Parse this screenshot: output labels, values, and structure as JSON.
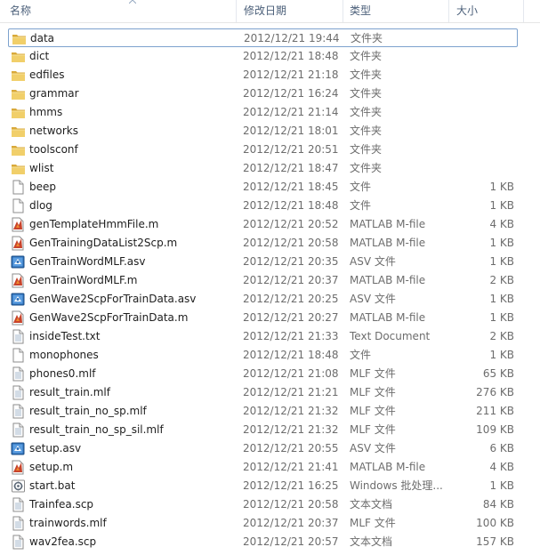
{
  "columns": {
    "name": "名称",
    "modified": "修改日期",
    "type": "类型",
    "size": "大小"
  },
  "colors": {
    "header_text": "#4c607a",
    "focus_border": "#7da2ce",
    "folder": "#e8c252",
    "matlab": "#c0392b"
  },
  "files": [
    {
      "name": "data",
      "date": "2012/12/21 19:44",
      "type": "文件夹",
      "size": "",
      "icon": "folder-icon"
    },
    {
      "name": "dict",
      "date": "2012/12/21 18:48",
      "type": "文件夹",
      "size": "",
      "icon": "folder-icon"
    },
    {
      "name": "edfiles",
      "date": "2012/12/21 21:18",
      "type": "文件夹",
      "size": "",
      "icon": "folder-icon"
    },
    {
      "name": "grammar",
      "date": "2012/12/21 16:24",
      "type": "文件夹",
      "size": "",
      "icon": "folder-icon"
    },
    {
      "name": "hmms",
      "date": "2012/12/21 21:14",
      "type": "文件夹",
      "size": "",
      "icon": "folder-icon"
    },
    {
      "name": "networks",
      "date": "2012/12/21 18:01",
      "type": "文件夹",
      "size": "",
      "icon": "folder-icon"
    },
    {
      "name": "toolsconf",
      "date": "2012/12/21 20:51",
      "type": "文件夹",
      "size": "",
      "icon": "folder-icon"
    },
    {
      "name": "wlist",
      "date": "2012/12/21 18:47",
      "type": "文件夹",
      "size": "",
      "icon": "folder-icon"
    },
    {
      "name": "beep",
      "date": "2012/12/21 18:45",
      "type": "文件",
      "size": "1 KB",
      "icon": "blank-file-icon"
    },
    {
      "name": "dlog",
      "date": "2012/12/21 18:48",
      "type": "文件",
      "size": "1 KB",
      "icon": "blank-file-icon"
    },
    {
      "name": "genTemplateHmmFile.m",
      "date": "2012/12/21 20:52",
      "type": "MATLAB M-file",
      "size": "4 KB",
      "icon": "matlab-file-icon"
    },
    {
      "name": "GenTrainingDataList2Scp.m",
      "date": "2012/12/21 20:58",
      "type": "MATLAB M-file",
      "size": "1 KB",
      "icon": "matlab-file-icon"
    },
    {
      "name": "GenTrainWordMLF.asv",
      "date": "2012/12/21 20:35",
      "type": "ASV 文件",
      "size": "1 KB",
      "icon": "asv-file-icon"
    },
    {
      "name": "GenTrainWordMLF.m",
      "date": "2012/12/21 20:37",
      "type": "MATLAB M-file",
      "size": "2 KB",
      "icon": "matlab-file-icon"
    },
    {
      "name": "GenWave2ScpForTrainData.asv",
      "date": "2012/12/21 20:25",
      "type": "ASV 文件",
      "size": "1 KB",
      "icon": "asv-file-icon"
    },
    {
      "name": "GenWave2ScpForTrainData.m",
      "date": "2012/12/21 20:27",
      "type": "MATLAB M-file",
      "size": "1 KB",
      "icon": "matlab-file-icon"
    },
    {
      "name": "insideTest.txt",
      "date": "2012/12/21 21:33",
      "type": "Text Document",
      "size": "2 KB",
      "icon": "text-file-icon"
    },
    {
      "name": "monophones",
      "date": "2012/12/21 18:48",
      "type": "文件",
      "size": "1 KB",
      "icon": "blank-file-icon"
    },
    {
      "name": "phones0.mlf",
      "date": "2012/12/21 21:08",
      "type": "MLF 文件",
      "size": "65 KB",
      "icon": "text-file-icon"
    },
    {
      "name": "result_train.mlf",
      "date": "2012/12/21 21:21",
      "type": "MLF 文件",
      "size": "276 KB",
      "icon": "text-file-icon"
    },
    {
      "name": "result_train_no_sp.mlf",
      "date": "2012/12/21 21:32",
      "type": "MLF 文件",
      "size": "211 KB",
      "icon": "text-file-icon"
    },
    {
      "name": "result_train_no_sp_sil.mlf",
      "date": "2012/12/21 21:32",
      "type": "MLF 文件",
      "size": "109 KB",
      "icon": "text-file-icon"
    },
    {
      "name": "setup.asv",
      "date": "2012/12/21 20:55",
      "type": "ASV 文件",
      "size": "6 KB",
      "icon": "asv-file-icon"
    },
    {
      "name": "setup.m",
      "date": "2012/12/21 21:41",
      "type": "MATLAB M-file",
      "size": "4 KB",
      "icon": "matlab-file-icon"
    },
    {
      "name": "start.bat",
      "date": "2012/12/21 16:25",
      "type": "Windows 批处理...",
      "size": "1 KB",
      "icon": "bat-file-icon"
    },
    {
      "name": "Trainfea.scp",
      "date": "2012/12/21 20:58",
      "type": "文本文档",
      "size": "84 KB",
      "icon": "text-file-icon"
    },
    {
      "name": "trainwords.mlf",
      "date": "2012/12/21 20:37",
      "type": "MLF 文件",
      "size": "100 KB",
      "icon": "text-file-icon"
    },
    {
      "name": "wav2fea.scp",
      "date": "2012/12/21 20:57",
      "type": "文本文档",
      "size": "157 KB",
      "icon": "text-file-icon"
    }
  ]
}
